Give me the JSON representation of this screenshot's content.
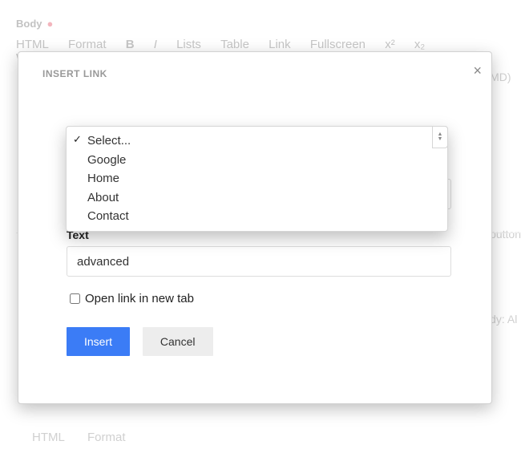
{
  "page": {
    "body_label": "Body",
    "toolbar": [
      "HTML",
      "Format",
      "B",
      "I",
      "Lists",
      "Table",
      "Link",
      "Fullscreen",
      "x²",
      "x₂",
      "Word count"
    ],
    "right_hints": [
      "MD)",
      "button",
      "dy: Al"
    ]
  },
  "modal": {
    "title": "INSERT LINK",
    "close_glyph": "×",
    "select_placeholder": "Select...",
    "select_options": [
      "Google",
      "Home",
      "About",
      "Contact"
    ],
    "text_label": "Text",
    "text_value": "advanced",
    "open_new_tab_label": "Open link in new tab",
    "insert_label": "Insert",
    "cancel_label": "Cancel"
  }
}
